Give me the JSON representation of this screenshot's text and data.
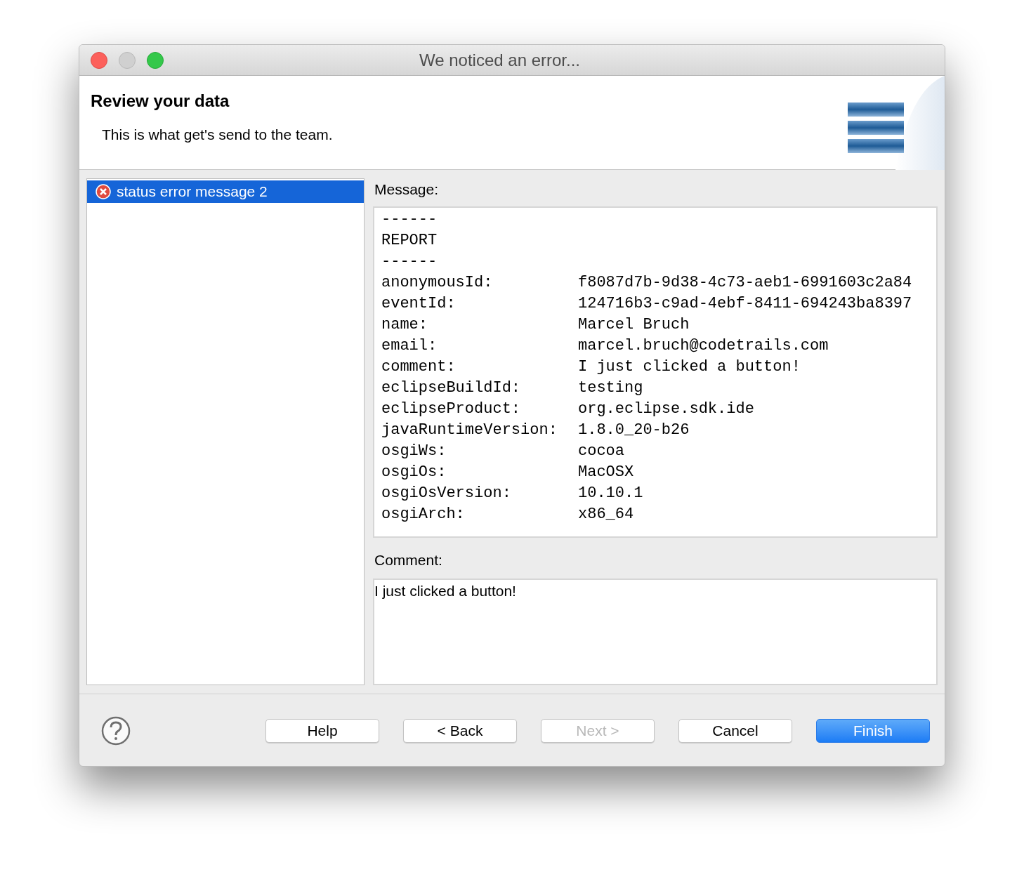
{
  "window": {
    "title": "We noticed an error..."
  },
  "header": {
    "title": "Review your data",
    "description": "This is what get's send to the team."
  },
  "status_list": [
    {
      "label": "status error message 2",
      "selected": true
    }
  ],
  "message": {
    "label": "Message:",
    "lines": [
      {
        "kind": "text",
        "text": "------"
      },
      {
        "kind": "text",
        "text": "REPORT"
      },
      {
        "kind": "text",
        "text": "------"
      },
      {
        "kind": "field",
        "key": "anonymousId:",
        "value": "f8087d7b-9d38-4c73-aeb1-6991603c2a84"
      },
      {
        "kind": "field",
        "key": "eventId:",
        "value": "124716b3-c9ad-4ebf-8411-694243ba8397"
      },
      {
        "kind": "field",
        "key": "name:",
        "value": "Marcel Bruch"
      },
      {
        "kind": "field",
        "key": "email:",
        "value": "marcel.bruch@codetrails.com"
      },
      {
        "kind": "field",
        "key": "comment:",
        "value": "I just clicked a button!"
      },
      {
        "kind": "field",
        "key": "eclipseBuildId:",
        "value": "testing"
      },
      {
        "kind": "field",
        "key": "eclipseProduct:",
        "value": "org.eclipse.sdk.ide"
      },
      {
        "kind": "field",
        "key": "javaRuntimeVersion:",
        "value": "1.8.0_20-b26"
      },
      {
        "kind": "field",
        "key": "osgiWs:",
        "value": "cocoa"
      },
      {
        "kind": "field",
        "key": "osgiOs:",
        "value": "MacOSX"
      },
      {
        "kind": "field",
        "key": "osgiOsVersion:",
        "value": "10.10.1"
      },
      {
        "kind": "field",
        "key": "osgiArch:",
        "value": "x86_64"
      }
    ]
  },
  "comment": {
    "label": "Comment:",
    "value": "I just clicked a button!"
  },
  "buttons": [
    {
      "label": "Help",
      "disabled": false,
      "default": false
    },
    {
      "label": "< Back",
      "disabled": false,
      "default": false
    },
    {
      "label": "Next >",
      "disabled": true,
      "default": false
    },
    {
      "label": "Cancel",
      "disabled": false,
      "default": false
    },
    {
      "label": "Finish",
      "disabled": false,
      "default": true
    }
  ]
}
